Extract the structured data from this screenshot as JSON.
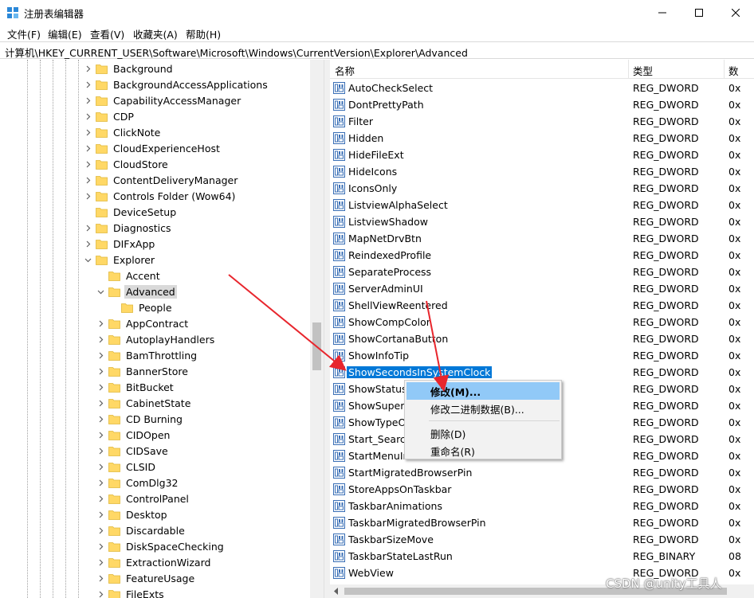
{
  "window": {
    "title": "注册表编辑器",
    "app_icon": "regedit-icon",
    "controls": [
      "minimize-icon",
      "maximize-icon",
      "close-icon"
    ]
  },
  "menu": {
    "items": [
      "文件(F)",
      "编辑(E)",
      "查看(V)",
      "收藏夹(A)",
      "帮助(H)"
    ]
  },
  "address": {
    "path": "计算机\\HKEY_CURRENT_USER\\Software\\Microsoft\\Windows\\CurrentVersion\\Explorer\\Advanced"
  },
  "tree": {
    "items": [
      {
        "label": "Background",
        "level": 0,
        "expander": "collapsed"
      },
      {
        "label": "BackgroundAccessApplications",
        "level": 0,
        "expander": "collapsed"
      },
      {
        "label": "CapabilityAccessManager",
        "level": 0,
        "expander": "collapsed"
      },
      {
        "label": "CDP",
        "level": 0,
        "expander": "collapsed"
      },
      {
        "label": "ClickNote",
        "level": 0,
        "expander": "collapsed"
      },
      {
        "label": "CloudExperienceHost",
        "level": 0,
        "expander": "collapsed"
      },
      {
        "label": "CloudStore",
        "level": 0,
        "expander": "collapsed"
      },
      {
        "label": "ContentDeliveryManager",
        "level": 0,
        "expander": "collapsed"
      },
      {
        "label": "Controls Folder (Wow64)",
        "level": 0,
        "expander": "collapsed"
      },
      {
        "label": "DeviceSetup",
        "level": 0,
        "expander": "none"
      },
      {
        "label": "Diagnostics",
        "level": 0,
        "expander": "collapsed"
      },
      {
        "label": "DIFxApp",
        "level": 0,
        "expander": "collapsed"
      },
      {
        "label": "Explorer",
        "level": 0,
        "expander": "expanded"
      },
      {
        "label": "Accent",
        "level": 1,
        "expander": "none"
      },
      {
        "label": "Advanced",
        "level": 1,
        "expander": "expanded",
        "selected": true
      },
      {
        "label": "People",
        "level": 2,
        "expander": "none"
      },
      {
        "label": "AppContract",
        "level": 1,
        "expander": "collapsed"
      },
      {
        "label": "AutoplayHandlers",
        "level": 1,
        "expander": "collapsed"
      },
      {
        "label": "BamThrottling",
        "level": 1,
        "expander": "collapsed"
      },
      {
        "label": "BannerStore",
        "level": 1,
        "expander": "collapsed"
      },
      {
        "label": "BitBucket",
        "level": 1,
        "expander": "collapsed"
      },
      {
        "label": "CabinetState",
        "level": 1,
        "expander": "collapsed"
      },
      {
        "label": "CD Burning",
        "level": 1,
        "expander": "collapsed"
      },
      {
        "label": "CIDOpen",
        "level": 1,
        "expander": "collapsed"
      },
      {
        "label": "CIDSave",
        "level": 1,
        "expander": "collapsed"
      },
      {
        "label": "CLSID",
        "level": 1,
        "expander": "collapsed"
      },
      {
        "label": "ComDlg32",
        "level": 1,
        "expander": "collapsed"
      },
      {
        "label": "ControlPanel",
        "level": 1,
        "expander": "collapsed"
      },
      {
        "label": "Desktop",
        "level": 1,
        "expander": "collapsed"
      },
      {
        "label": "Discardable",
        "level": 1,
        "expander": "collapsed"
      },
      {
        "label": "DiskSpaceChecking",
        "level": 1,
        "expander": "collapsed"
      },
      {
        "label": "ExtractionWizard",
        "level": 1,
        "expander": "collapsed"
      },
      {
        "label": "FeatureUsage",
        "level": 1,
        "expander": "collapsed"
      },
      {
        "label": "FileExts",
        "level": 1,
        "expander": "collapsed"
      }
    ]
  },
  "list": {
    "columns": {
      "name": "名称",
      "type": "类型",
      "data": "数"
    },
    "rows": [
      {
        "name": "AutoCheckSelect",
        "type": "REG_DWORD",
        "data": "0x"
      },
      {
        "name": "DontPrettyPath",
        "type": "REG_DWORD",
        "data": "0x"
      },
      {
        "name": "Filter",
        "type": "REG_DWORD",
        "data": "0x"
      },
      {
        "name": "Hidden",
        "type": "REG_DWORD",
        "data": "0x"
      },
      {
        "name": "HideFileExt",
        "type": "REG_DWORD",
        "data": "0x"
      },
      {
        "name": "HideIcons",
        "type": "REG_DWORD",
        "data": "0x"
      },
      {
        "name": "IconsOnly",
        "type": "REG_DWORD",
        "data": "0x"
      },
      {
        "name": "ListviewAlphaSelect",
        "type": "REG_DWORD",
        "data": "0x"
      },
      {
        "name": "ListviewShadow",
        "type": "REG_DWORD",
        "data": "0x"
      },
      {
        "name": "MapNetDrvBtn",
        "type": "REG_DWORD",
        "data": "0x"
      },
      {
        "name": "ReindexedProfile",
        "type": "REG_DWORD",
        "data": "0x"
      },
      {
        "name": "SeparateProcess",
        "type": "REG_DWORD",
        "data": "0x"
      },
      {
        "name": "ServerAdminUI",
        "type": "REG_DWORD",
        "data": "0x"
      },
      {
        "name": "ShellViewReentered",
        "type": "REG_DWORD",
        "data": "0x"
      },
      {
        "name": "ShowCompColor",
        "type": "REG_DWORD",
        "data": "0x"
      },
      {
        "name": "ShowCortanaButton",
        "type": "REG_DWORD",
        "data": "0x"
      },
      {
        "name": "ShowInfoTip",
        "type": "REG_DWORD",
        "data": "0x"
      },
      {
        "name": "ShowSecondsInSystemClock",
        "type": "REG_DWORD",
        "data": "0x",
        "selected": true
      },
      {
        "name": "ShowStatusB",
        "type": "REG_DWORD",
        "data": "0x"
      },
      {
        "name": "ShowSuperH",
        "type": "REG_DWORD",
        "data": "0x"
      },
      {
        "name": "ShowTypeO",
        "type": "REG_DWORD",
        "data": "0x"
      },
      {
        "name": "Start_Search",
        "type": "REG_DWORD",
        "data": "0x"
      },
      {
        "name": "StartMenuIr",
        "type": "REG_DWORD",
        "data": "0x"
      },
      {
        "name": "StartMigratedBrowserPin",
        "type": "REG_DWORD",
        "data": "0x"
      },
      {
        "name": "StoreAppsOnTaskbar",
        "type": "REG_DWORD",
        "data": "0x"
      },
      {
        "name": "TaskbarAnimations",
        "type": "REG_DWORD",
        "data": "0x"
      },
      {
        "name": "TaskbarMigratedBrowserPin",
        "type": "REG_DWORD",
        "data": "0x"
      },
      {
        "name": "TaskbarSizeMove",
        "type": "REG_DWORD",
        "data": "0x"
      },
      {
        "name": "TaskbarStateLastRun",
        "type": "REG_BINARY",
        "data": "08"
      },
      {
        "name": "WebView",
        "type": "REG_DWORD",
        "data": "0x"
      }
    ]
  },
  "context_menu": {
    "items": [
      {
        "label": "修改(M)...",
        "bold": true,
        "hover": true
      },
      {
        "label": "修改二进制数据(B)..."
      },
      {
        "separator": true
      },
      {
        "label": "删除(D)"
      },
      {
        "label": "重命名(R)"
      }
    ]
  },
  "watermark": "CSDN @unity工具人",
  "colors": {
    "selection_blue": "#0078d7",
    "menu_hover": "#91c9f7",
    "arrow_red": "#e8262d",
    "folder_yellow": "#ffd866"
  }
}
